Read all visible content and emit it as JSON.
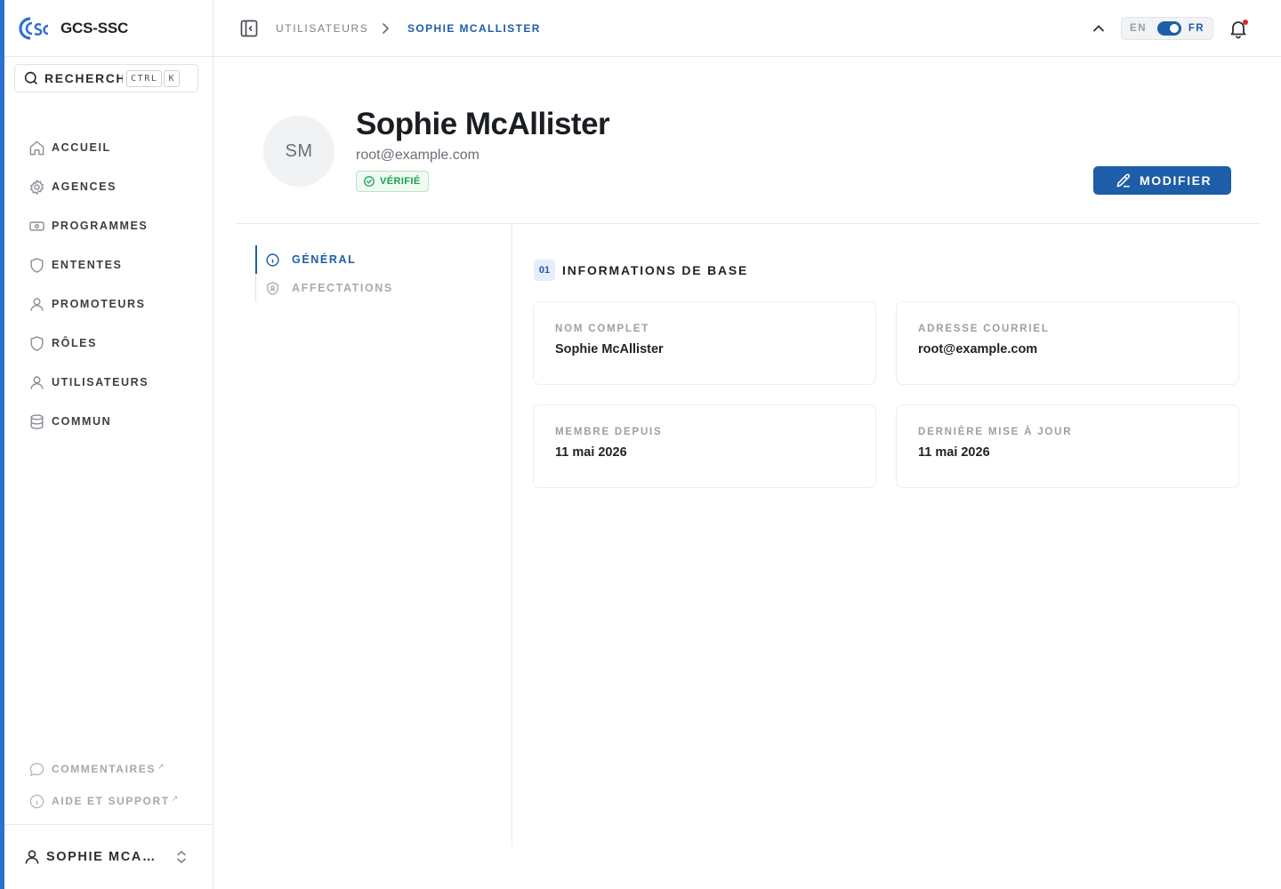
{
  "brand": {
    "name": "GCS-SSC"
  },
  "search": {
    "label": "RECHERCHER",
    "shortcut": [
      "CTRL",
      "K"
    ]
  },
  "sidebar": {
    "items": [
      {
        "label": "ACCUEIL",
        "icon": "home-icon"
      },
      {
        "label": "AGENCES",
        "icon": "gear-icon"
      },
      {
        "label": "PROGRAMMES",
        "icon": "banknote-icon"
      },
      {
        "label": "ENTENTES",
        "icon": "shield-icon"
      },
      {
        "label": "PROMOTEURS",
        "icon": "user-icon"
      },
      {
        "label": "RÔLES",
        "icon": "shield-icon"
      },
      {
        "label": "UTILISATEURS",
        "icon": "user-icon"
      },
      {
        "label": "COMMUN",
        "icon": "database-icon"
      }
    ],
    "footer": [
      {
        "label": "COMMENTAIRES",
        "icon": "message-icon"
      },
      {
        "label": "AIDE ET SUPPORT",
        "icon": "info-icon"
      }
    ],
    "user": {
      "name": "SOPHIE MCALLISTER"
    }
  },
  "breadcrumb": {
    "parent": "UTILISATEURS",
    "current": "SOPHIE MCALLISTER"
  },
  "language": {
    "left": "EN",
    "right": "FR",
    "active": "FR"
  },
  "profile": {
    "initials": "SM",
    "name": "Sophie McAllister",
    "email": "root@example.com",
    "badge": "VÉRIFIÉ",
    "edit_label": "MODIFIER"
  },
  "tabs": [
    {
      "label": "GÉNÉRAL",
      "active": true
    },
    {
      "label": "AFFECTATIONS",
      "active": false
    }
  ],
  "section": {
    "number": "01",
    "title": "INFORMATIONS DE BASE",
    "fields": [
      {
        "label": "NOM COMPLET",
        "value": "Sophie McAllister"
      },
      {
        "label": "ADRESSE COURRIEL",
        "value": "root@example.com"
      },
      {
        "label": "MEMBRE DEPUIS",
        "value": "11 mai 2026"
      },
      {
        "label": "DERNIÈRE MISE À JOUR",
        "value": "11 mai 2026"
      }
    ]
  },
  "colors": {
    "accent": "#1e5da8",
    "success": "#1b9f4f",
    "notification": "#e0252a"
  }
}
